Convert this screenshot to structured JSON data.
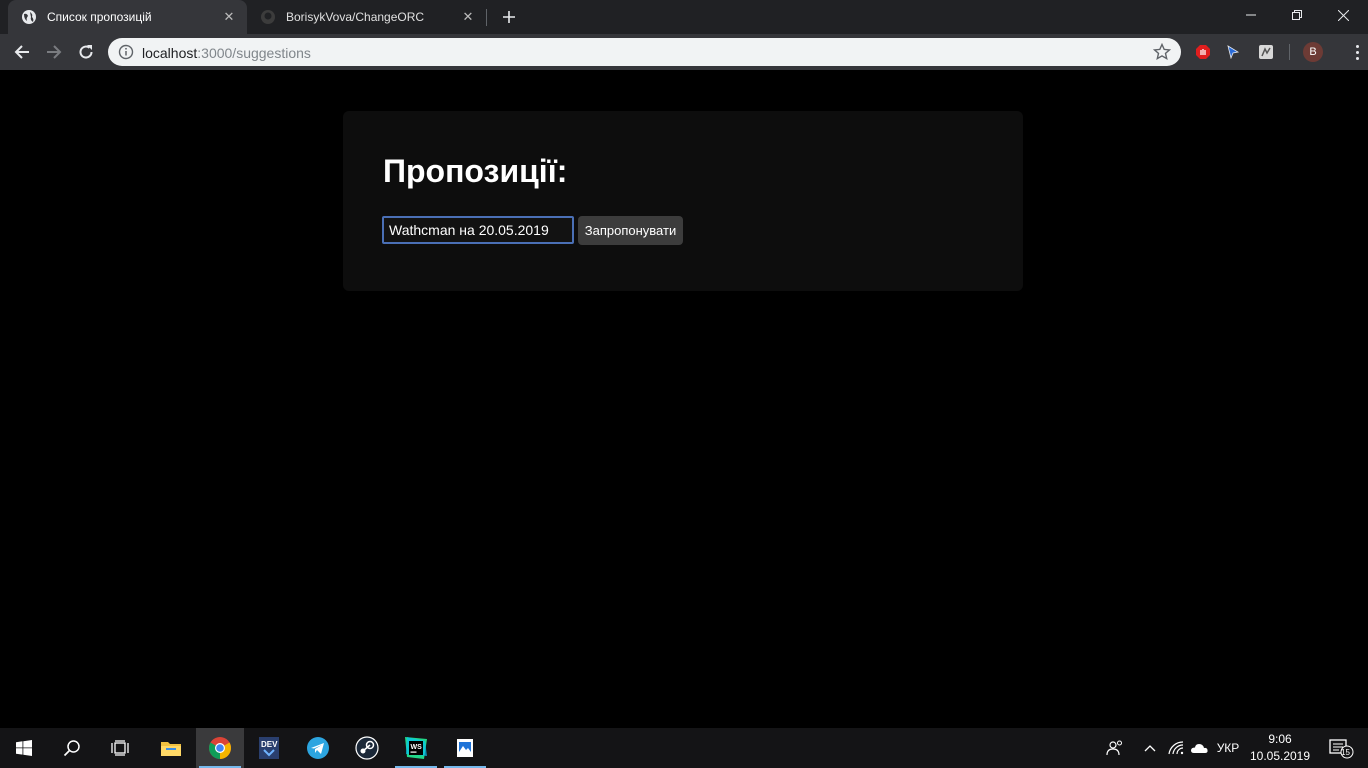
{
  "browser": {
    "tabs": [
      {
        "title": "Список пропозицій",
        "active": true
      },
      {
        "title": "BorisykVova/ChangeORC",
        "active": false
      }
    ],
    "url": {
      "host": "localhost",
      "path": ":3000/suggestions"
    },
    "profile_initial": "B"
  },
  "page": {
    "heading": "Пропозиції:",
    "input_value": "Wathcman на 20.05.2019",
    "submit_label": "Запропонувати"
  },
  "taskbar": {
    "language": "УКР",
    "time": "9:06",
    "date": "10.05.2019",
    "notifications_count": "15",
    "apps": [
      "start",
      "search",
      "task-view",
      "file-explorer",
      "chrome",
      "devexpress",
      "telegram",
      "steam",
      "webstorm",
      "photos"
    ]
  }
}
